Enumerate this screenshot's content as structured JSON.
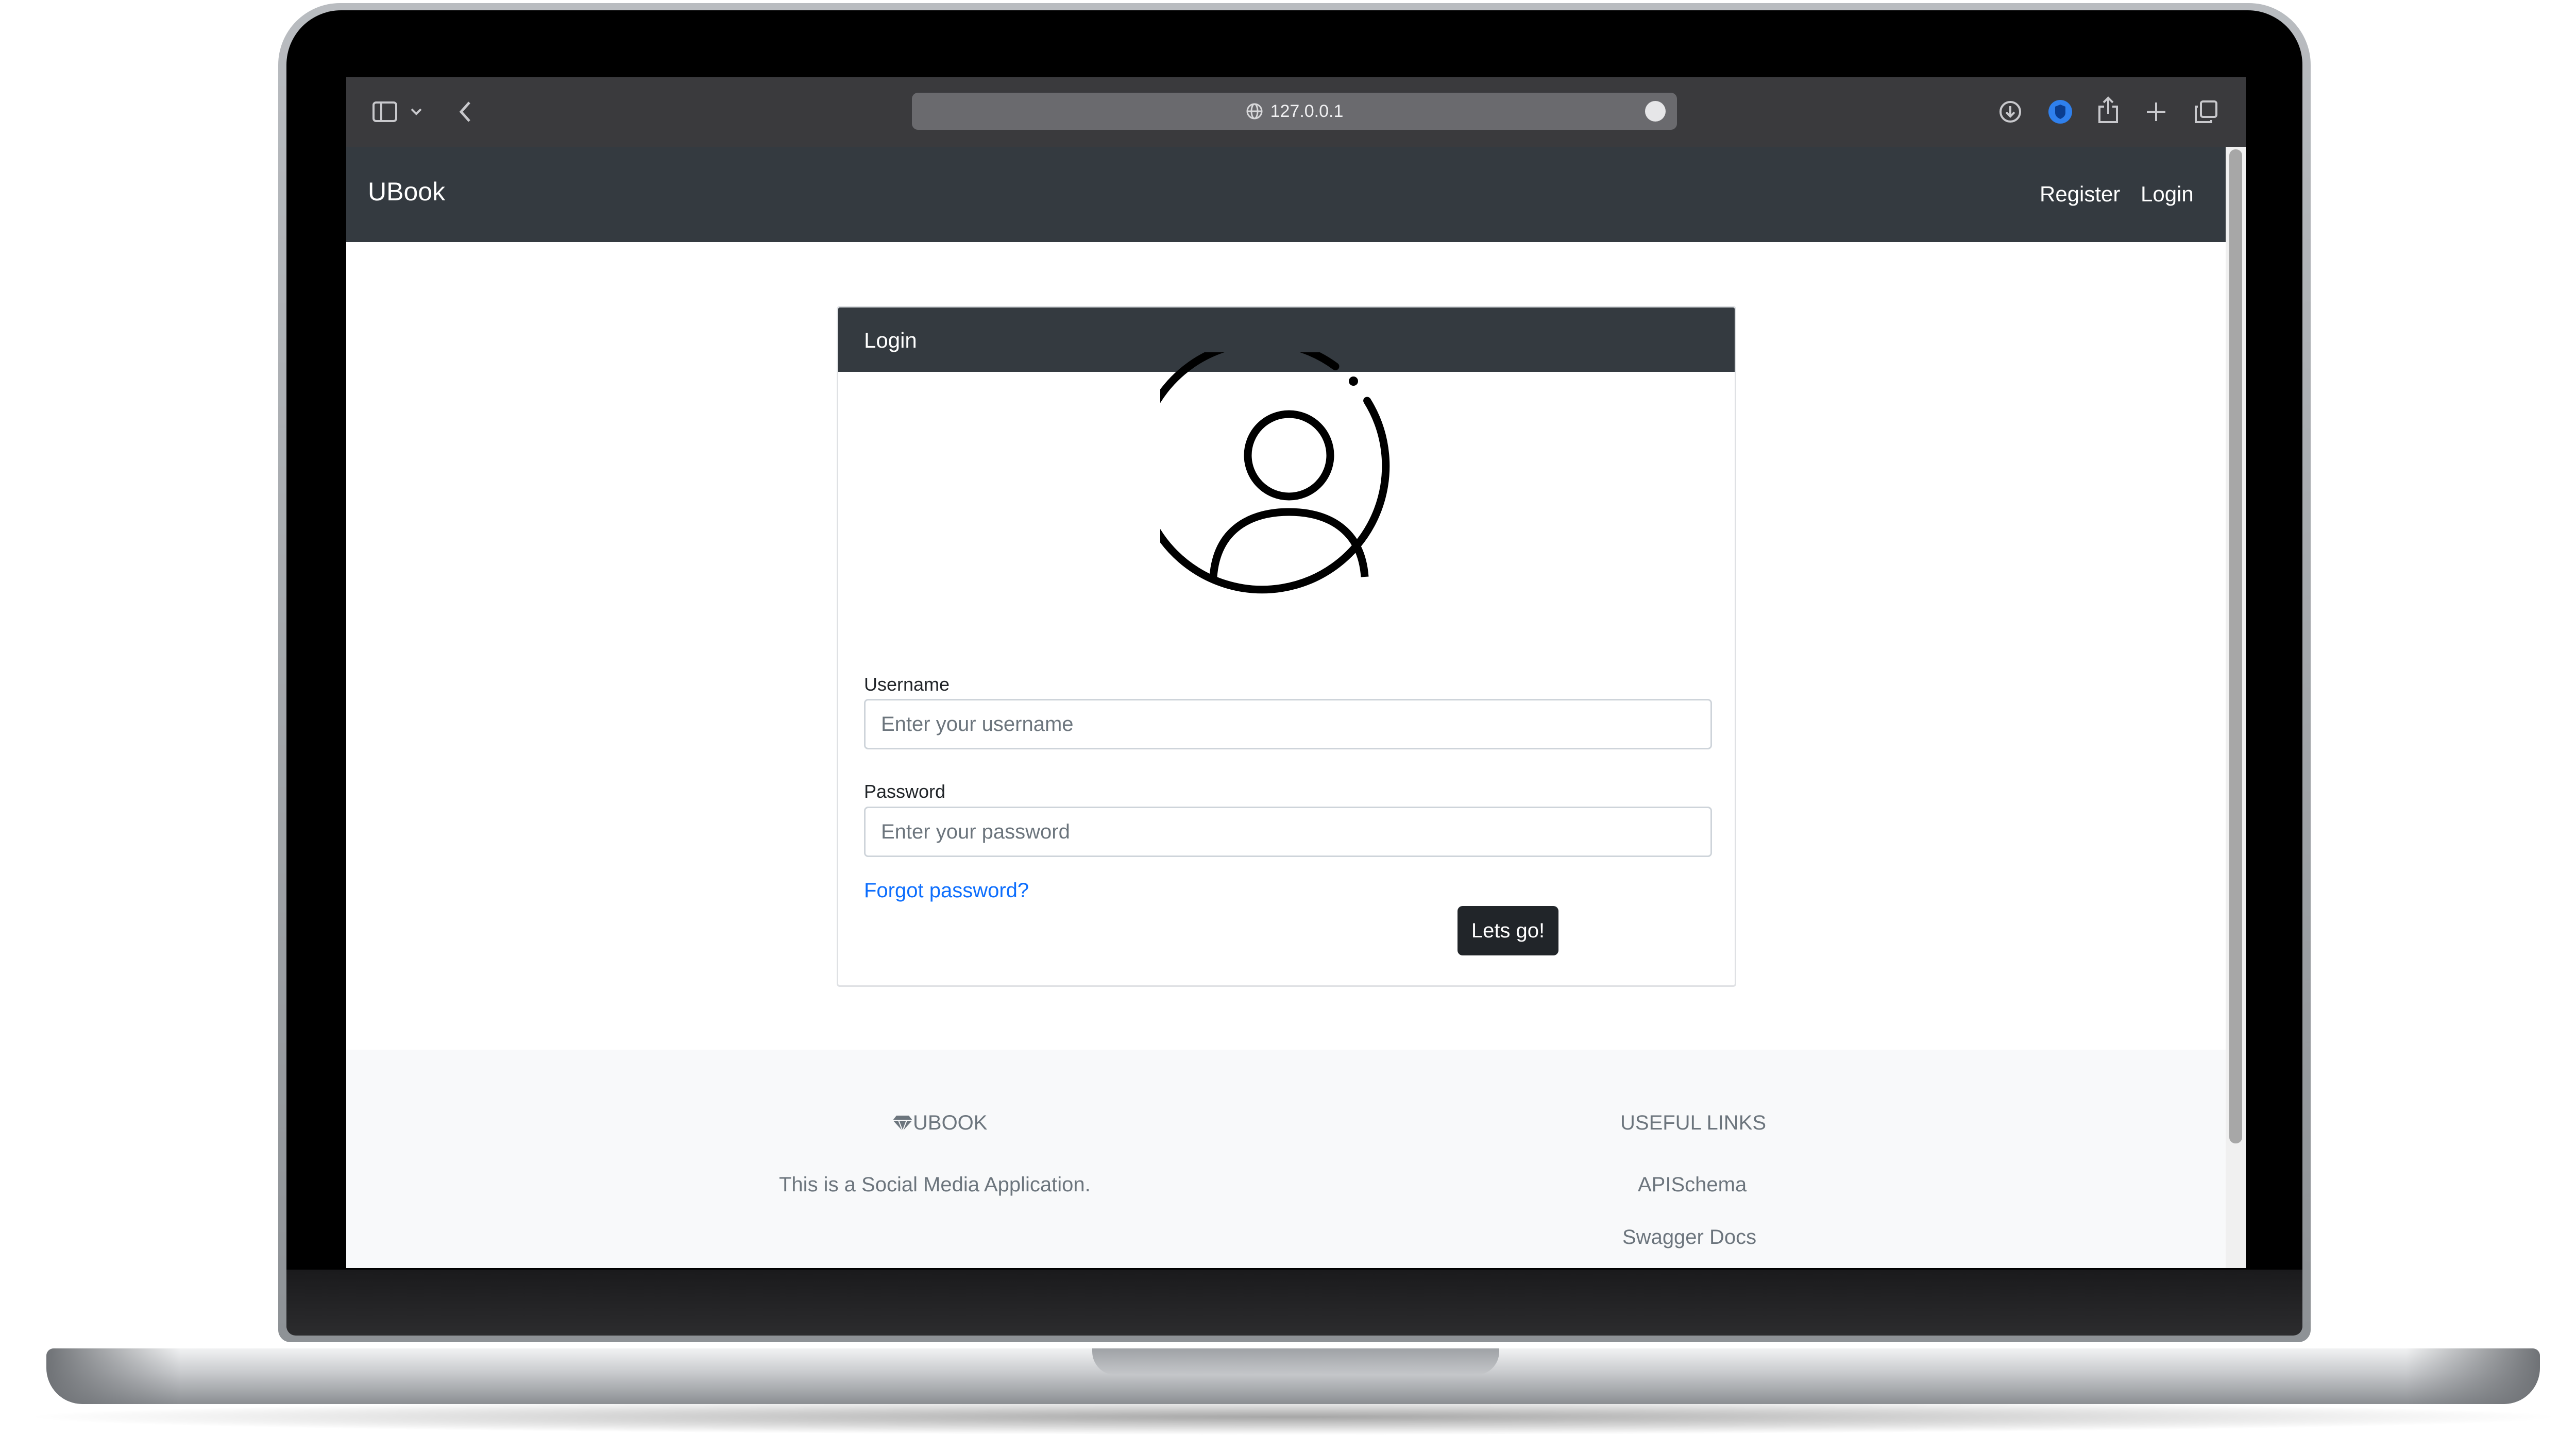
{
  "browser": {
    "url": "127.0.0.1"
  },
  "navbar": {
    "brand": "UBook",
    "links": [
      "Register",
      "Login"
    ]
  },
  "login_card": {
    "header": "Login",
    "username_label": "Username",
    "username_placeholder": "Enter your username",
    "password_label": "Password",
    "password_placeholder": "Enter your password",
    "forgot_link": "Forgot password?",
    "submit_label": "Lets go!"
  },
  "footer": {
    "brand_heading": "UBOOK",
    "brand_icon": "gem-icon",
    "description": "This is a Social Media Application.",
    "links_heading": "USEFUL LINKS",
    "links": [
      "APISchema",
      "Swagger Docs"
    ]
  },
  "colors": {
    "navbar_bg": "#343a40",
    "link_blue": "#0d6efd",
    "button_dark": "#212529",
    "footer_bg": "#f8f9fa"
  }
}
